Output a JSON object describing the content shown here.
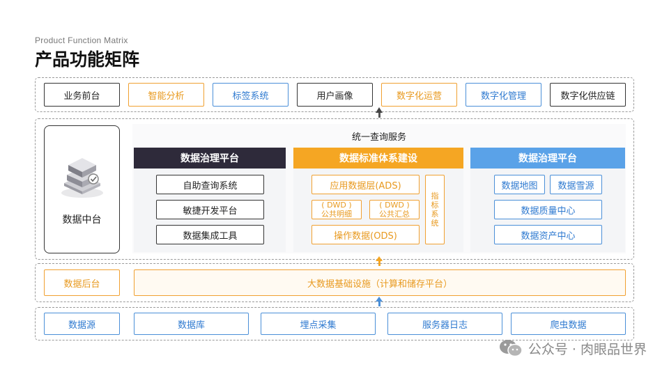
{
  "header": {
    "subtitle": "Product Function Matrix",
    "title": "产品功能矩阵"
  },
  "top_row": [
    "业务前台",
    "智能分析",
    "标签系统",
    "用户画像",
    "数字化运营",
    "数字化管理",
    "数字化供应链"
  ],
  "middle": {
    "platform_label": "数据中台",
    "service_title": "统一查询服务",
    "left_panel": {
      "header": "数据治理平台",
      "items": [
        "自助查询系统",
        "敏捷开发平台",
        "数据集成工具"
      ]
    },
    "center_panel": {
      "header": "数据标准体系建设",
      "ads": "应用数据层(ADS)",
      "dwd1_top": "( DWD )",
      "dwd1_bottom": "公共明细",
      "dwd2_top": "( DWD )",
      "dwd2_bottom": "公共汇总",
      "ods": "操作数据(ODS)",
      "side": [
        "指",
        "标",
        "系",
        "统"
      ]
    },
    "right_panel": {
      "header": "数据治理平台",
      "items": [
        "数据地图",
        "数据雪源",
        "数据质量中心",
        "数据资产中心"
      ]
    }
  },
  "backend": {
    "label": "数据后台",
    "infra": "大数据基础设施（计算和储存平台）"
  },
  "sources": [
    "数据源",
    "数据库",
    "埋点采集",
    "服务器日志",
    "爬虫数据"
  ],
  "watermark": "公众号 · 肉眼品世界",
  "colors": {
    "dark": "#2e2a3a",
    "orange": "#f5a623",
    "blue": "#5aa2e8"
  }
}
